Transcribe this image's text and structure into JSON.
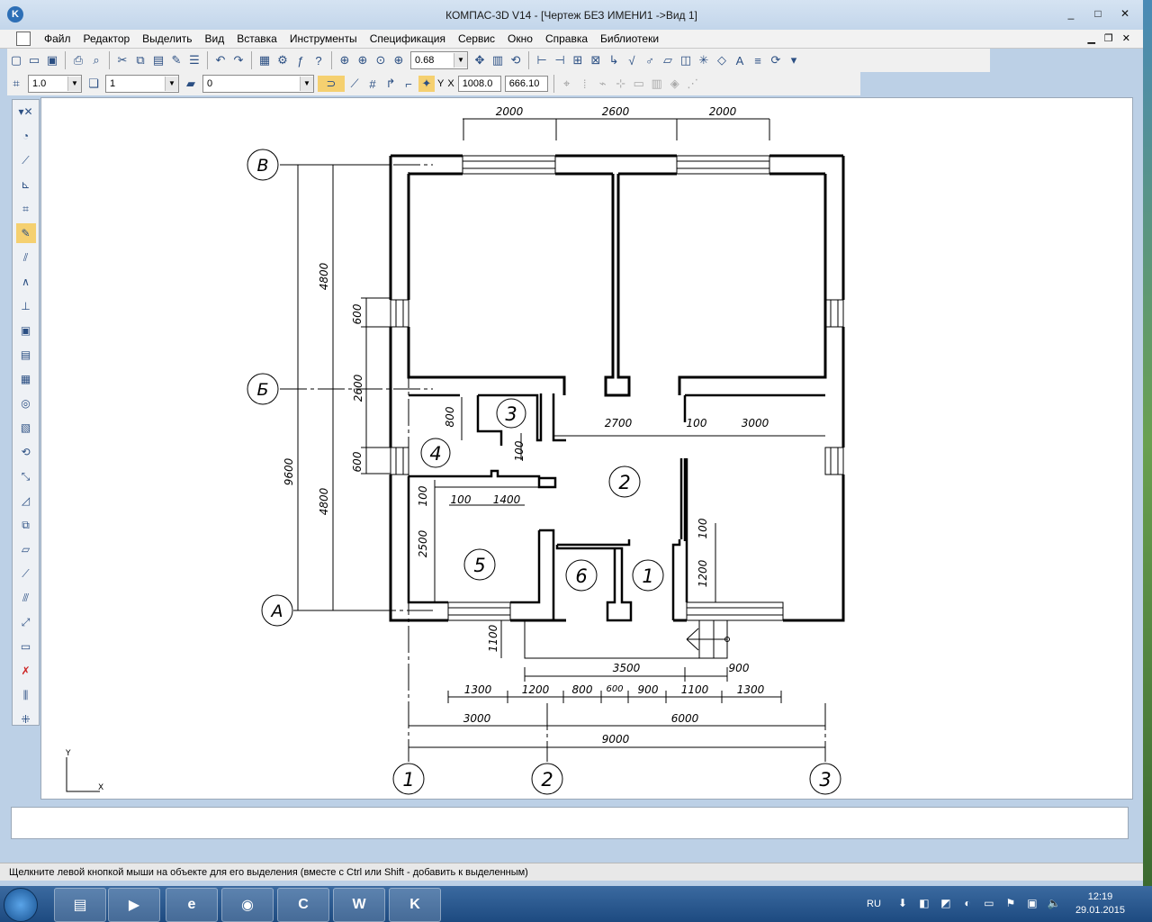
{
  "window": {
    "title": "КОМПАС-3D V14 - [Чертеж БЕЗ ИМЕНИ1 ->Вид 1]",
    "controls": [
      "_",
      "□",
      "✕"
    ]
  },
  "menu": [
    "Файл",
    "Редактор",
    "Выделить",
    "Вид",
    "Вставка",
    "Инструменты",
    "Спецификация",
    "Сервис",
    "Окно",
    "Справка",
    "Библиотеки"
  ],
  "toolbar1": {
    "zoom": "0.68"
  },
  "toolbar2": {
    "scale": "1.0",
    "layer": "1",
    "style": "0",
    "x_label": "X",
    "y_label": "Y",
    "x": "1008.0",
    "y": "666.10"
  },
  "drawing": {
    "axes_letters": [
      "В",
      "Б",
      "А"
    ],
    "axes_numbers": [
      "1",
      "2",
      "3"
    ],
    "rooms": [
      "1",
      "2",
      "3",
      "4",
      "5",
      "6"
    ],
    "dims_top": [
      "2000",
      "2600",
      "2000"
    ],
    "dims_left": [
      "4800",
      "2600",
      "4800",
      "9600"
    ],
    "dims_inner_left": [
      "600",
      "2600",
      "600"
    ],
    "dims_inner": [
      "800",
      "100",
      "2700",
      "100",
      "3000",
      "100",
      "1400",
      "100",
      "2500",
      "100",
      "1200",
      "1100"
    ],
    "dims_bottom_row1": [
      "3500",
      "900"
    ],
    "dims_bottom_row2": [
      "1300",
      "1200",
      "800",
      "600",
      "900",
      "1100",
      "1300"
    ],
    "dims_bottom_row3": [
      "3000",
      "6000"
    ],
    "dims_bottom_total": "9000",
    "axis_y": "Y",
    "axis_x": "X"
  },
  "status": "Щелкните левой кнопкой мыши на объекте для его выделения (вместе с Ctrl или Shift - добавить к выделенным)",
  "tray": {
    "lang": "RU",
    "time": "12:19",
    "date": "29.01.2015"
  }
}
